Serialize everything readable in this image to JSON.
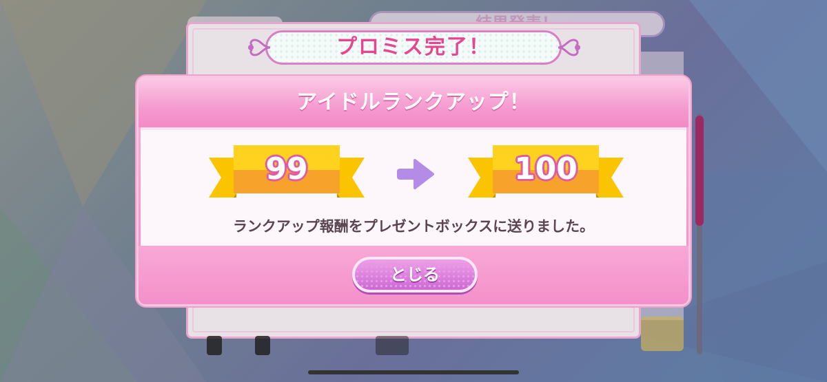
{
  "background": {
    "back_header_text": "結果発表！"
  },
  "promise": {
    "title": "プロミス完了！"
  },
  "modal": {
    "title": "アイドルランクアップ！",
    "rank_before": "99",
    "rank_after": "100",
    "message": "ランクアップ報酬をプレゼントボックスに送りました。",
    "close_label": "とじる"
  },
  "colors": {
    "accent_pink": "#f48ac6",
    "title_pink": "#e5468f",
    "ribbon_gold": "#fbc400",
    "arrow_purple": "#b48be6",
    "button_purple": "#cc69d4"
  }
}
